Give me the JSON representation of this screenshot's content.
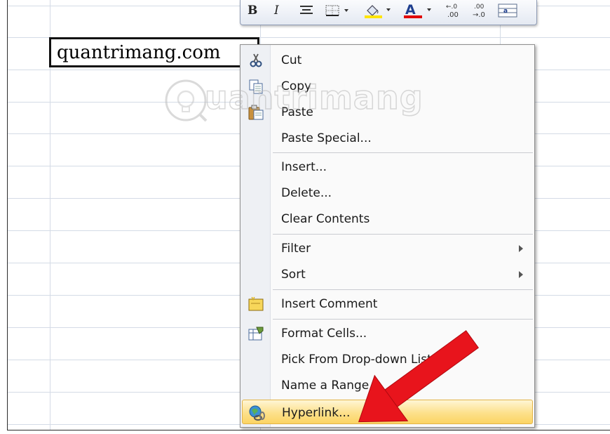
{
  "cell": {
    "value": "quantrimang.com"
  },
  "toolbar": {
    "bold_label": "B",
    "italic_label": "I",
    "font_color": "#e00000",
    "fill_color": "#ffe400"
  },
  "context_menu": {
    "items": [
      {
        "label": "Cut",
        "icon": "scissors-icon"
      },
      {
        "label": "Copy",
        "icon": "copy-icon"
      },
      {
        "label": "Paste",
        "icon": "paste-icon"
      },
      {
        "label": "Paste Special...",
        "icon": ""
      },
      {
        "label": "Insert...",
        "icon": ""
      },
      {
        "label": "Delete...",
        "icon": ""
      },
      {
        "label": "Clear Contents",
        "icon": ""
      },
      {
        "label": "Filter",
        "icon": "",
        "submenu": true
      },
      {
        "label": "Sort",
        "icon": "",
        "submenu": true
      },
      {
        "label": "Insert Comment",
        "icon": "comment-icon"
      },
      {
        "label": "Format Cells...",
        "icon": "format-cells-icon"
      },
      {
        "label": "Pick From Drop-down List...",
        "icon": ""
      },
      {
        "label": "Name a Range...",
        "icon": ""
      },
      {
        "label": "Hyperlink...",
        "icon": "hyperlink-icon",
        "highlighted": true
      }
    ]
  },
  "watermark": {
    "text": "uantrimang"
  },
  "colors": {
    "highlight": "#fde08b",
    "arrow": "#e8141c",
    "grid": "#d4dbe6"
  }
}
